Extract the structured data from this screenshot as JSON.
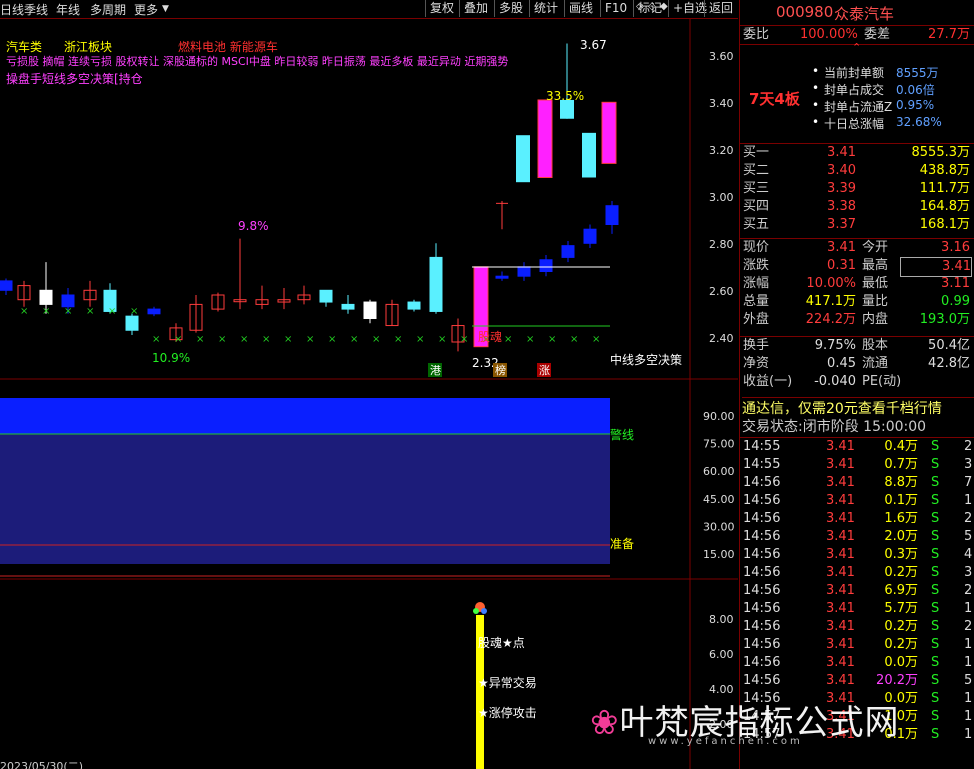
{
  "toolbar": {
    "left": [
      "日线",
      "季线",
      "年线",
      "多周期",
      "更多"
    ],
    "right": [
      "复权",
      "叠加",
      "多股",
      "统计",
      "画线",
      "F10",
      "标记",
      "+自选",
      "返回"
    ]
  },
  "overlay_text": {
    "line1": [
      "汽车类",
      "浙江板块",
      "燃料电池 新能源车"
    ],
    "line2": "亏损股 摘帽 连续亏损 股权转让 深股通标的 MSCI中盘 昨日较弱 昨日振荡 最近多板 最近异动 近期强势",
    "line3": "操盘手短线多空决策[持仓",
    "board_tag": "7天4板",
    "high_label": "3.67",
    "low_label": "2.32",
    "pct_33": "33.5%",
    "pct_98": "9.8%",
    "pct_109": "10.9%",
    "duanhun": "股魂",
    "tag_gang": "港",
    "tag_bang": "榜",
    "tag_zhang": "涨",
    "strategy": "中线多空决策",
    "jingxian": "警线",
    "zhunbei": "准备",
    "duanhun_point": "股魂★点",
    "yichang": "★异常交易",
    "zhangting": "★涨停攻击",
    "date": "2023/05/30(二)",
    "bottom_7": "7",
    "bottom_right": "日线"
  },
  "y_axis_main": [
    "3.60",
    "3.40",
    "3.20",
    "3.00",
    "2.80",
    "2.60",
    "2.40"
  ],
  "y_axis_mid": [
    "90.00",
    "75.00",
    "60.00",
    "45.00",
    "30.00",
    "15.00"
  ],
  "y_axis_low": [
    "8.00",
    "6.00",
    "4.00",
    "2.00"
  ],
  "stock": {
    "code": "000980",
    "name": "众泰汽车"
  },
  "weibi": {
    "label": "委比",
    "value": "100.00%",
    "label2": "委差",
    "value2": "27.7万"
  },
  "seal": {
    "rows": [
      {
        "label": "当前封单额",
        "value": "8555万"
      },
      {
        "label": "封单占成交",
        "value": "0.06倍"
      },
      {
        "label": "封单占流通Z",
        "value": "0.95%"
      },
      {
        "label": "十日总涨幅",
        "value": "32.68%"
      }
    ]
  },
  "bids": [
    {
      "label": "买一",
      "price": "3.41",
      "vol": "8555.3万"
    },
    {
      "label": "买二",
      "price": "3.40",
      "vol": "438.8万"
    },
    {
      "label": "买三",
      "price": "3.39",
      "vol": "111.7万"
    },
    {
      "label": "买四",
      "price": "3.38",
      "vol": "164.8万"
    },
    {
      "label": "买五",
      "price": "3.37",
      "vol": "168.1万"
    }
  ],
  "quote": [
    {
      "l1": "现价",
      "v1": "3.41",
      "l2": "今开",
      "v2": "3.16"
    },
    {
      "l1": "涨跌",
      "v1": "0.31",
      "l2": "最高",
      "v2": "3.41"
    },
    {
      "l1": "涨幅",
      "v1": "10.00%",
      "l2": "最低",
      "v2": "3.11"
    },
    {
      "l1": "总量",
      "v1": "417.1万",
      "l2": "量比",
      "v2": "0.99"
    },
    {
      "l1": "外盘",
      "v1": "224.2万",
      "l2": "内盘",
      "v2": "193.0万"
    }
  ],
  "fund": [
    {
      "l1": "换手",
      "v1": "9.75%",
      "l2": "股本",
      "v2": "50.4亿"
    },
    {
      "l1": "净资",
      "v1": "0.45",
      "l2": "流通",
      "v2": "42.8亿"
    },
    {
      "l1": "收益(一)",
      "v1": "-0.040",
      "l2": "PE(动)",
      "v2": ""
    }
  ],
  "promo": "通达信，仅需20元查看千档行情",
  "trade_status": "交易状态:闭市阶段 15:00:00",
  "ticks": [
    {
      "t": "14:55",
      "p": "3.41",
      "v": "0.4万",
      "s": "S",
      "n": "2"
    },
    {
      "t": "14:55",
      "p": "3.41",
      "v": "0.7万",
      "s": "S",
      "n": "3"
    },
    {
      "t": "14:56",
      "p": "3.41",
      "v": "8.8万",
      "s": "S",
      "n": "7"
    },
    {
      "t": "14:56",
      "p": "3.41",
      "v": "0.1万",
      "s": "S",
      "n": "1"
    },
    {
      "t": "14:56",
      "p": "3.41",
      "v": "1.6万",
      "s": "S",
      "n": "2"
    },
    {
      "t": "14:56",
      "p": "3.41",
      "v": "2.0万",
      "s": "S",
      "n": "5"
    },
    {
      "t": "14:56",
      "p": "3.41",
      "v": "0.3万",
      "s": "S",
      "n": "4"
    },
    {
      "t": "14:56",
      "p": "3.41",
      "v": "0.2万",
      "s": "S",
      "n": "3"
    },
    {
      "t": "14:56",
      "p": "3.41",
      "v": "6.9万",
      "s": "S",
      "n": "2"
    },
    {
      "t": "14:56",
      "p": "3.41",
      "v": "5.7万",
      "s": "S",
      "n": "1"
    },
    {
      "t": "14:56",
      "p": "3.41",
      "v": "0.2万",
      "s": "S",
      "n": "2"
    },
    {
      "t": "14:56",
      "p": "3.41",
      "v": "0.2万",
      "s": "S",
      "n": "1"
    },
    {
      "t": "14:56",
      "p": "3.41",
      "v": "0.0万",
      "s": "S",
      "n": "1"
    },
    {
      "t": "14:56",
      "p": "3.41",
      "v": "20.2万",
      "s": "S",
      "n": "5"
    },
    {
      "t": "14:56",
      "p": "3.41",
      "v": "0.0万",
      "s": "S",
      "n": "1"
    },
    {
      "t": "14:57",
      "p": "3.41",
      "v": "1.0万",
      "s": "S",
      "n": "1"
    },
    {
      "t": "14:57",
      "p": "3.41",
      "v": "0.1万",
      "s": "S",
      "n": "1"
    }
  ],
  "watermark": {
    "title": "叶梵宸指标公式网",
    "url": "www.yefanchen.com"
  },
  "colors": {
    "up": "#ff3c3c",
    "down": "#5af0ff",
    "blue": "#0a1fff",
    "magenta": "#ff20ff",
    "yellow": "#ffff00",
    "purple_panel": "#1c1c7a"
  }
}
